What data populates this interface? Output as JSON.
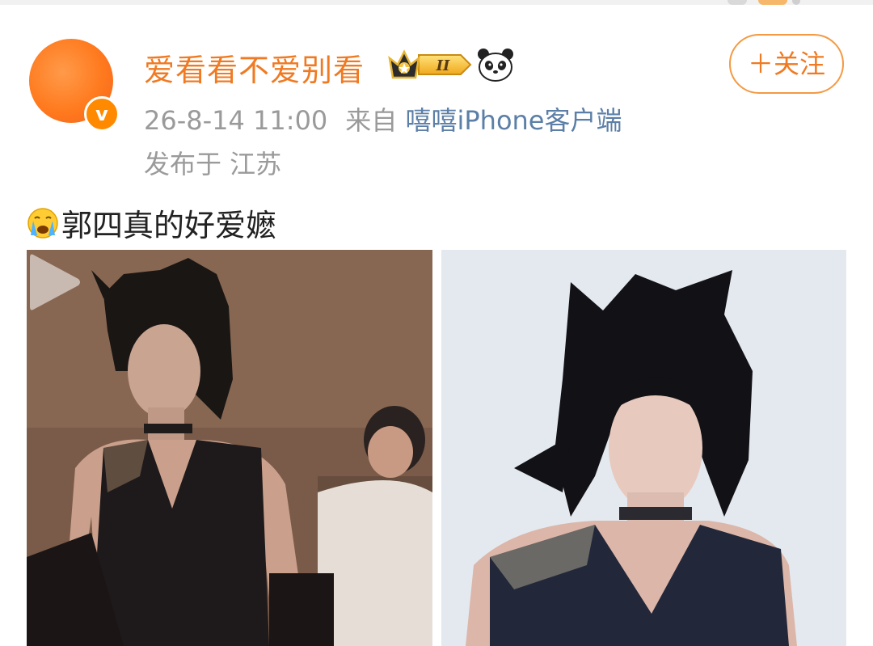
{
  "post": {
    "author": {
      "name": "爱看看不爱别看",
      "verified_mark": "v",
      "member_level": "II"
    },
    "follow_label": "＋关注",
    "time": "26-8-14 11:00",
    "source_prefix": "来自",
    "source": "嘻嘻iPhone客户端",
    "location": "发布于 江苏",
    "text": "郭四真的好爱嬷",
    "media": [
      {
        "kind": "video",
        "icon": "play-icon"
      },
      {
        "kind": "image"
      }
    ]
  },
  "icons": {
    "avatar_color": "#ff7a1e",
    "accent": "#f07a22",
    "link": "#5c7fa7",
    "muted": "#9a9a9a",
    "vip_icon": "crown-badge-icon",
    "emoji_icon": "panda-icon",
    "text_emoji": "crying-face-icon"
  }
}
